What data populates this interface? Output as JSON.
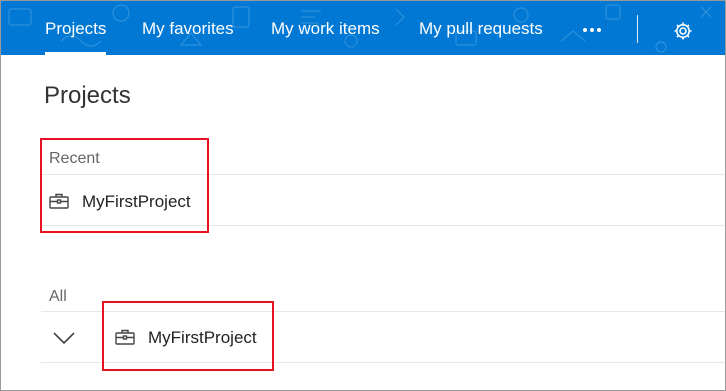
{
  "nav": {
    "tabs": [
      {
        "label": "Projects",
        "active": true
      },
      {
        "label": "My favorites",
        "active": false
      },
      {
        "label": "My work items",
        "active": false
      },
      {
        "label": "My pull requests",
        "active": false
      }
    ],
    "more_icon": "ellipsis-icon",
    "settings_icon": "gear-icon",
    "bar_color": "#0078d4"
  },
  "main": {
    "title": "Projects",
    "recent": {
      "label": "Recent",
      "projects": [
        {
          "name": "MyFirstProject",
          "icon": "briefcase-icon"
        }
      ]
    },
    "all": {
      "label": "All",
      "projects": [
        {
          "name": "MyFirstProject",
          "icon": "briefcase-icon",
          "expand_icon": "chevron-down-icon"
        }
      ]
    }
  },
  "annotation_color": "#e81123"
}
